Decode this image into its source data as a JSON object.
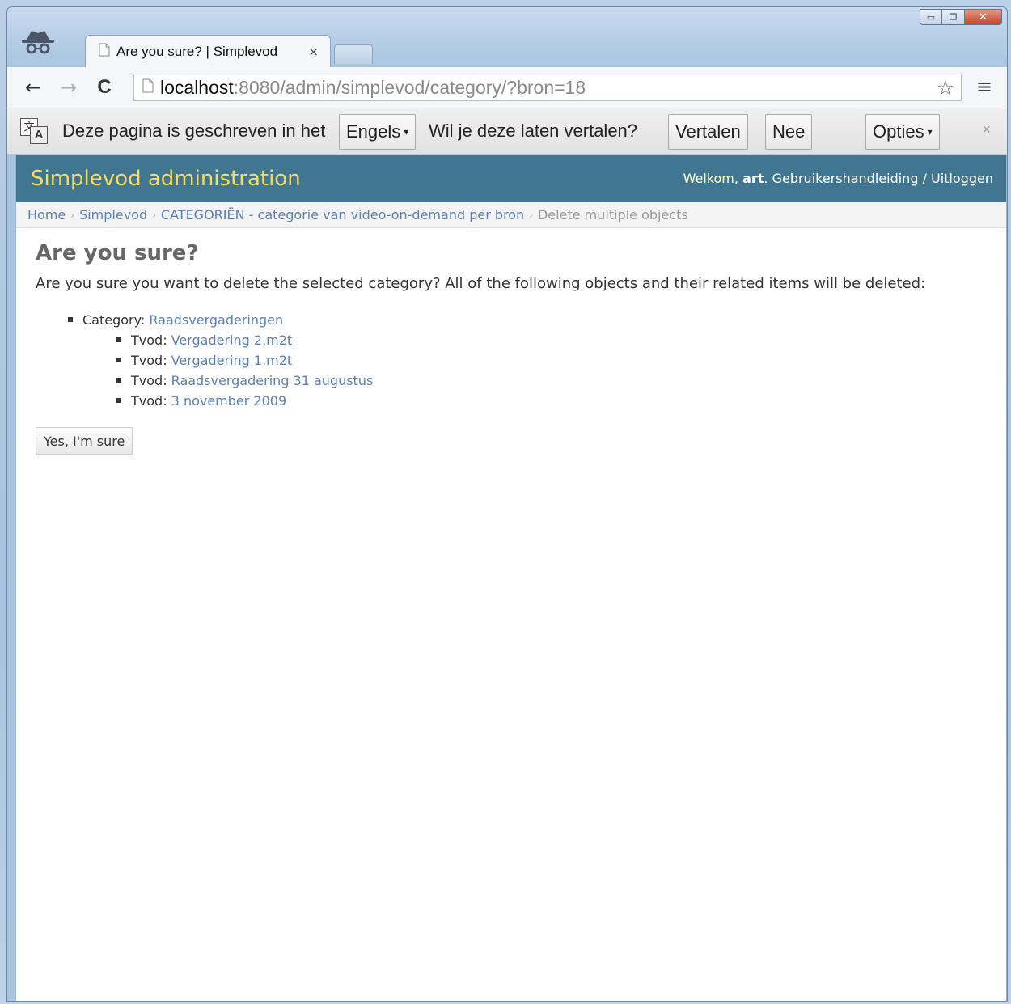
{
  "window": {
    "minimize_icon": "minimize-icon",
    "maximize_icon": "maximize-icon",
    "close_icon": "close-icon",
    "minimize_glyph": "▭",
    "maximize_glyph": "❐",
    "close_glyph": "✕"
  },
  "tab": {
    "title": "Are you sure? | Simplevod",
    "close_glyph": "×"
  },
  "toolbar": {
    "back_glyph": "←",
    "forward_glyph": "→",
    "reload_glyph": "C",
    "url_host": "localhost",
    "url_rest": ":8080/admin/simplevod/category/?bron=18",
    "star_glyph": "☆",
    "menu_glyph": "≡"
  },
  "translate_bar": {
    "prefix": "Deze pagina is geschreven in het",
    "language": "Engels",
    "question": "Wil je deze laten vertalen?",
    "translate_label": "Vertalen",
    "no_label": "Nee",
    "options_label": "Opties",
    "caret": "▾",
    "close_glyph": "×",
    "icon_a": "文",
    "icon_b": "A"
  },
  "header": {
    "site_name": "Simplevod administration",
    "welcome": "Welkom, ",
    "username": "art",
    "dot": ". ",
    "docs_link": "Gebruikershandleiding",
    "slash": " / ",
    "logout_link": "Uitloggen"
  },
  "breadcrumbs": {
    "separator": "›",
    "home": "Home",
    "app": "Simplevod",
    "model": "CATEGORIËN - categorie van video-on-demand per bron",
    "current": "Delete multiple objects"
  },
  "main": {
    "title": "Are you sure?",
    "intro": "Are you sure you want to delete the selected category? All of the following objects and their related items will be deleted:",
    "category_label": "Category: ",
    "category_name": "Raadsvergaderingen",
    "tvod_label": "Tvod: ",
    "tvods": [
      "Vergadering 2.m2t",
      "Vergadering 1.m2t",
      "Raadsvergadering 31 augustus",
      "3 november 2009"
    ],
    "confirm_label": "Yes, I'm sure"
  }
}
